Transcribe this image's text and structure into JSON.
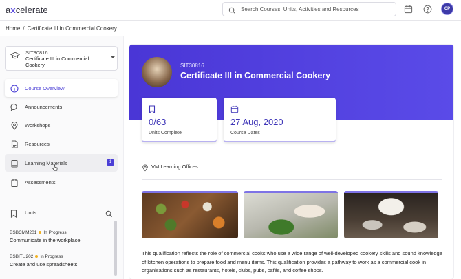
{
  "app": {
    "logo_prefix": "a",
    "logo_x": "x",
    "logo_suffix": "celerate",
    "avatar_initials": "CP"
  },
  "search": {
    "placeholder": "Search Courses, Units, Activities and Resources"
  },
  "breadcrumb": {
    "home": "Home",
    "separator": "/",
    "current": "Certificate III in Commercial Cookery"
  },
  "course_select": {
    "code": "SIT30816",
    "title": "Certificate III in Commercial Cookery"
  },
  "nav": {
    "items": [
      {
        "label": "Course Overview",
        "icon": "info-icon"
      },
      {
        "label": "Announcements",
        "icon": "chat-bubble-icon"
      },
      {
        "label": "Workshops",
        "icon": "location-pin-icon"
      },
      {
        "label": "Resources",
        "icon": "document-icon"
      },
      {
        "label": "Learning Materials",
        "icon": "book-icon",
        "badge": "1"
      },
      {
        "label": "Assessments",
        "icon": "clipboard-icon"
      }
    ]
  },
  "units": {
    "heading": "Units",
    "list": [
      {
        "code": "BSBCMM201",
        "status": "In Progress",
        "name": "Communicate in the workplace"
      },
      {
        "code": "BSBITU202",
        "status": "In Progress",
        "name": "Create and use spreadsheets"
      }
    ]
  },
  "hero": {
    "code": "SIT30816",
    "title": "Certificate III in Commercial Cookery"
  },
  "stats": {
    "units": {
      "value": "0/63",
      "label": "Units Complete"
    },
    "dates": {
      "value": "27 Aug, 2020",
      "label": "Course Dates"
    }
  },
  "location": {
    "text": "VM Learning Offices"
  },
  "description": "This qualification reflects the role of commercial cooks who use a wide range of well-developed cookery skills and sound knowledge of kitchen operations to prepare food and menu items. This qualification provides a pathway to work as a commercial cook in organisations such as restaurants, hotels, clubs, pubs, cafés, and coffee shops.",
  "colors": {
    "accent": "#4b3fd6",
    "hero": "#4a36d6",
    "status_dot": "#f2b01e"
  }
}
